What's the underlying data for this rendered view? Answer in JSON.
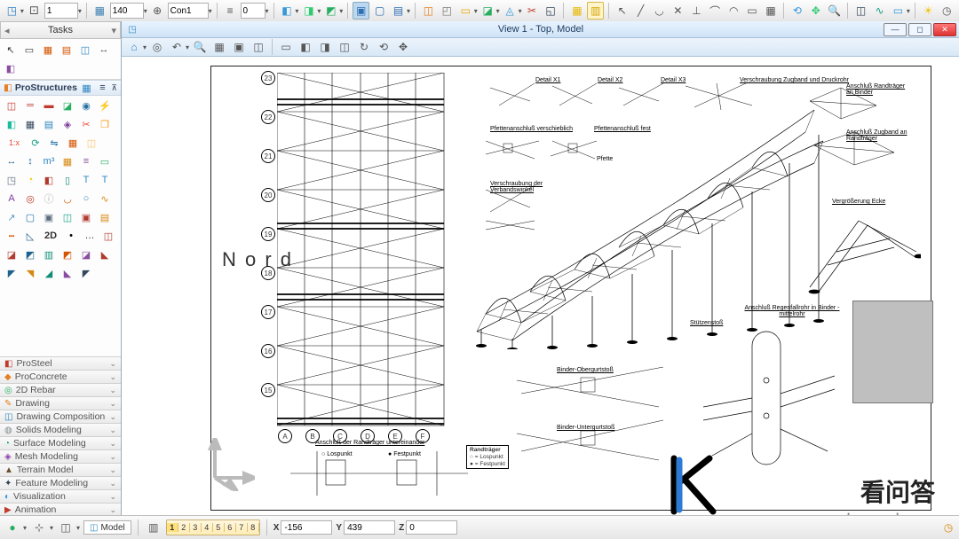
{
  "top": {
    "level_value": "1",
    "layer_value": "140",
    "combo_value": "Con1",
    "percent_value": "0"
  },
  "sidebar": {
    "tasks_title": "Tasks",
    "sections": {
      "prostructures": "ProStructures",
      "2d_label": "2D"
    },
    "categories": [
      {
        "key": "prosteel",
        "label": "ProSteel",
        "sym": "◧",
        "clr": "#c0392b"
      },
      {
        "key": "proconcrete",
        "label": "ProConcrete",
        "sym": "◆",
        "clr": "#e67e22"
      },
      {
        "key": "2drebar",
        "label": "2D Rebar",
        "sym": "◎",
        "clr": "#27ae60"
      },
      {
        "key": "drawing",
        "label": "Drawing",
        "sym": "✎",
        "clr": "#e67e22"
      },
      {
        "key": "drawingcomp",
        "label": "Drawing Composition",
        "sym": "◫",
        "clr": "#2980b9"
      },
      {
        "key": "solids",
        "label": "Solids Modeling",
        "sym": "◍",
        "clr": "#7f8c8d"
      },
      {
        "key": "surface",
        "label": "Surface Modeling",
        "sym": "◔",
        "clr": "#16a085"
      },
      {
        "key": "mesh",
        "label": "Mesh Modeling",
        "sym": "◈",
        "clr": "#8e44ad"
      },
      {
        "key": "terrain",
        "label": "Terrain Model",
        "sym": "▲",
        "clr": "#6b4f2a"
      },
      {
        "key": "feature",
        "label": "Feature Modeling",
        "sym": "✦",
        "clr": "#2c3e50"
      },
      {
        "key": "visualization",
        "label": "Visualization",
        "sym": "◐",
        "clr": "#3498db"
      },
      {
        "key": "animation",
        "label": "Animation",
        "sym": "▶",
        "clr": "#c0392b"
      }
    ]
  },
  "view": {
    "title": "View 1 - Top, Model"
  },
  "drawing": {
    "nord": "N o r d",
    "grid_rows": [
      "23",
      "22",
      "21",
      "20",
      "19",
      "18",
      "17",
      "16",
      "15"
    ],
    "grid_row_bottom": [
      "A",
      "B",
      "C",
      "D",
      "E",
      "F"
    ],
    "annotations": {
      "pf_verschieblich": "Pfettenanschluß verschieblich",
      "pf_fest": "Pfettenanschluß fest",
      "verschraubung_verband": "Verschraubung der Verbandswinkel",
      "verschraubung_zugband": "Verschraubung Zugband und Druckrohr",
      "anschluss_randtr_binder": "Anschluß Randträger an Binder",
      "anschluss_zugband_randtr": "Anschluß Zugband an Randträger",
      "vergroesserung_ecke": "Vergrößerung Ecke",
      "anschluss_regenfallrohr": "Anschluß Regenfallrohr in Binder - mittelrohr",
      "binder_obergurt": "Binder-Obergurtstoß",
      "binder_untergurt": "Binder-Untergurtstoß",
      "anschluss_randtr_untereinander": "Anschluß der Randträger untereinander",
      "stuetzenstoss": "Stützenstoß",
      "randtraeger": "Randträger",
      "lospunkt": "Lospunkt",
      "festpunkt": "Festpunkt",
      "detail_x1": "Detail X1",
      "detail_x2": "Detail X2",
      "detail_x3": "Detail X3",
      "pfette": "Pfette"
    }
  },
  "status": {
    "breadcrumb": "Model",
    "pages": [
      "1",
      "2",
      "3",
      "4",
      "5",
      "6",
      "7",
      "8"
    ],
    "active_page": "1",
    "x_label": "X",
    "x_value": "-156",
    "y_label": "Y",
    "y_value": "439",
    "z_label": "Z",
    "z_value": "0"
  },
  "watermark": {
    "cn": "看问答",
    "url": "www.kanwenda.com"
  }
}
